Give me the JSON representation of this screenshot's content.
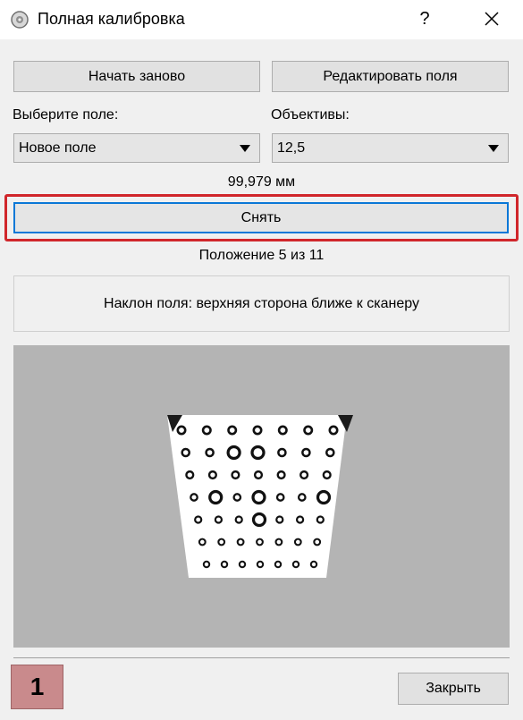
{
  "window": {
    "title": "Полная калибровка",
    "help_label": "?"
  },
  "toolbar": {
    "restart_label": "Начать заново",
    "edit_fields_label": "Редактировать поля"
  },
  "field_select": {
    "label": "Выберите поле:",
    "value": "Новое поле"
  },
  "lens_select": {
    "label": "Объективы:",
    "value": "12,5"
  },
  "measurement": "99,979 мм",
  "shoot_button": "Снять",
  "position_text": "Положение 5 из 11",
  "instruction": "Наклон поля: верхняя сторона ближе к сканеру",
  "step_badge": "1",
  "close_button": "Закрыть",
  "colors": {
    "highlight": "#d0262b",
    "focus_border": "#0a78d7",
    "preview_bg": "#b4b4b4",
    "badge": "#c98a8c"
  }
}
